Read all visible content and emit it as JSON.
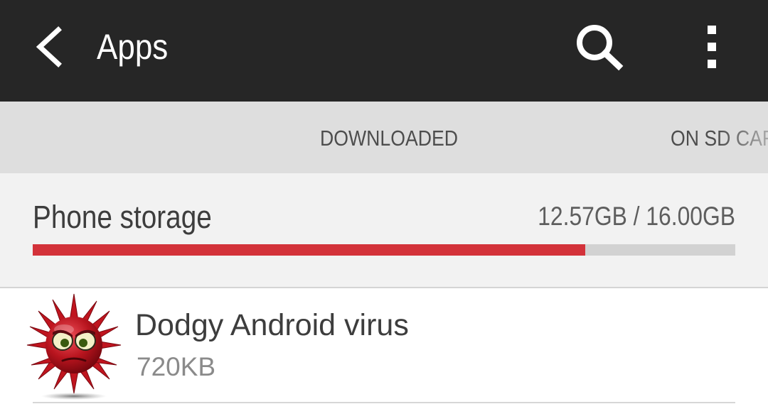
{
  "header": {
    "title": "Apps",
    "back_icon": "back-arrow-icon",
    "search_icon": "search-icon",
    "overflow_icon": "overflow-menu-icon"
  },
  "tabs": [
    {
      "label": "DOWNLOADED",
      "selected": true
    },
    {
      "label": "ON SD CAR"
    }
  ],
  "storage": {
    "label": "Phone storage",
    "amount": "12.57GB / 16.00GB",
    "used_fraction": 0.786
  },
  "apps": [
    {
      "name": "Dodgy Android virus",
      "size": "720KB",
      "icon": "virus-app-icon"
    }
  ],
  "colors": {
    "action_bar": "#262626",
    "tab_bar": "#dedede",
    "storage_fill": "#d3323a",
    "storage_track": "#d2d2d2",
    "panel_background": "#f2f2f2"
  }
}
